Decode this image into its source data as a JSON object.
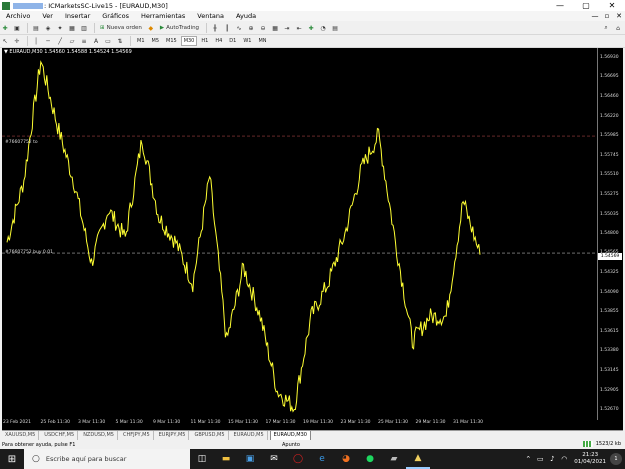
{
  "window": {
    "title": ": ICMarketsSC-Live15 - [EURAUD,M30]",
    "controls": [
      "—",
      "▢",
      "✕"
    ]
  },
  "menu": {
    "items": [
      "Archivo",
      "Ver",
      "Insertar",
      "Gráficos",
      "Herramientas",
      "Ventana",
      "Ayuda"
    ],
    "right_controls": [
      "—",
      "▫",
      "✕"
    ]
  },
  "toolbar": {
    "new_order_label": "Nueva orden",
    "autotrading_label": "AutoTrading"
  },
  "timeframes": {
    "items": [
      "M1",
      "M5",
      "M15",
      "M30",
      "H1",
      "H4",
      "D1",
      "W1",
      "MN"
    ],
    "active": "M30"
  },
  "chart": {
    "symbol_label": "▼ EURAUD,M30  1.54560  1.54588  1.54524  1.54569",
    "price_tag": "1.54569",
    "ann_red": "#76607752 to",
    "ann_pos": "#76607752 buy 0.01",
    "colors": {
      "background": "#000000",
      "line": "#ffff33",
      "grid_h": "#a04040",
      "grid_b": "#b0b0b0"
    }
  },
  "chart_data": {
    "type": "line",
    "symbol": "EURAUD",
    "timeframe": "M30",
    "x_ticks": [
      "23 Feb 2021",
      "25 Feb 11:30",
      "3 Mar 11:30",
      "5 Mar 11:30",
      "9 Mar 11:30",
      "11 Mar 11:30",
      "15 Mar 11:30",
      "17 Mar 11:30",
      "19 Mar 11:30",
      "23 Mar 11:30",
      "25 Mar 11:30",
      "29 Mar 11:30",
      "31 Mar 11:30"
    ],
    "y_ticks": [
      "1.56930",
      "1.56695",
      "1.56460",
      "1.56220",
      "1.55985",
      "1.55745",
      "1.55510",
      "1.55275",
      "1.55035",
      "1.54800",
      "1.54565",
      "1.54325",
      "1.54090",
      "1.53855",
      "1.53615",
      "1.53380",
      "1.53145",
      "1.52905",
      "1.52670"
    ],
    "ylim": [
      1.5267,
      1.5693
    ],
    "horizontal_lines": [
      1.55985,
      1.54569
    ],
    "series": [
      {
        "x": [
          "23 Feb 2021",
          "24 Feb",
          "25 Feb",
          "26 Feb",
          "1 Mar",
          "2 Mar",
          "3 Mar",
          "4 Mar",
          "5 Mar",
          "6 Mar",
          "8 Mar",
          "9 Mar",
          "10 Mar",
          "11 Mar",
          "12 Mar",
          "15 Mar",
          "16 Mar",
          "17 Mar",
          "18 Mar",
          "19 Mar",
          "22 Mar",
          "23 Mar",
          "24 Mar",
          "25 Mar",
          "26 Mar",
          "29 Mar",
          "30 Mar",
          "31 Mar",
          "1 Apr"
        ],
        "values": [
          1.547,
          1.5545,
          1.569,
          1.561,
          1.554,
          1.5445,
          1.551,
          1.5475,
          1.5595,
          1.55,
          1.547,
          1.542,
          1.555,
          1.535,
          1.544,
          1.538,
          1.529,
          1.527,
          1.538,
          1.542,
          1.548,
          1.556,
          1.56,
          1.547,
          1.535,
          1.538,
          1.538,
          1.552,
          1.5455
        ]
      }
    ]
  },
  "tabs": {
    "items": [
      "XAUUSD,M5",
      "USDCHF,M5",
      "NZDUSD,M5",
      "CHFJPY,M5",
      "EURJPY,M5",
      "GBPUSD,M5",
      "EURAUD,M5",
      "EURAUD,M30"
    ],
    "active": "EURAUD,M30"
  },
  "status": {
    "help": "Para obtener ayuda, pulse F1",
    "profile": "Apunto",
    "traffic": "1523/2 kb"
  },
  "taskbar": {
    "search_placeholder": "Escribe aquí para buscar",
    "time": "21:23",
    "date": "01/04/2021",
    "notifications": "1",
    "apps": [
      "task-view",
      "explorer",
      "store",
      "mail",
      "opera",
      "edge",
      "firefox",
      "spotify",
      "terminal",
      "metatrader"
    ]
  }
}
